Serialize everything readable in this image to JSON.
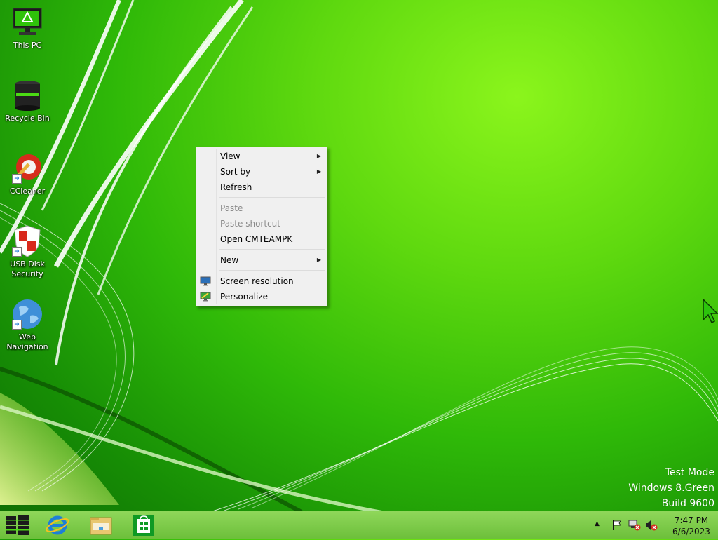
{
  "desktop": {
    "icons": [
      {
        "label": "This PC",
        "icon": "monitor-icon"
      },
      {
        "label": "Recycle Bin",
        "icon": "recycle-bin-icon"
      },
      {
        "label": "CCleaner",
        "icon": "ccleaner-icon"
      },
      {
        "label": "USB Disk\nSecurity",
        "icon": "shield-icon"
      },
      {
        "label": "Web\nNavigation",
        "icon": "globe-icon"
      }
    ]
  },
  "context_menu": {
    "groups": [
      [
        {
          "label": "View",
          "submenu": true,
          "enabled": true
        },
        {
          "label": "Sort by",
          "submenu": true,
          "enabled": true
        },
        {
          "label": "Refresh",
          "submenu": false,
          "enabled": true
        }
      ],
      [
        {
          "label": "Paste",
          "submenu": false,
          "enabled": false
        },
        {
          "label": "Paste shortcut",
          "submenu": false,
          "enabled": false
        },
        {
          "label": "Open CMTEAMPK",
          "submenu": false,
          "enabled": true
        }
      ],
      [
        {
          "label": "New",
          "submenu": true,
          "enabled": true
        }
      ],
      [
        {
          "label": "Screen resolution",
          "icon": "display-icon",
          "enabled": true
        },
        {
          "label": "Personalize",
          "icon": "personalize-icon",
          "enabled": true
        }
      ]
    ]
  },
  "watermark": {
    "line1": "Test Mode",
    "line2": "Windows 8.Green",
    "line3": "Build 9600"
  },
  "taskbar": {
    "pinned": [
      "start-button",
      "internet-explorer-icon",
      "file-explorer-icon",
      "store-icon"
    ],
    "clock": {
      "time": "7:47 PM",
      "date": "6/6/2023"
    }
  },
  "colors": {
    "accent": "#5fd90f",
    "menu_bg": "#f0f0f0",
    "taskbar": "#7dcb4a"
  }
}
